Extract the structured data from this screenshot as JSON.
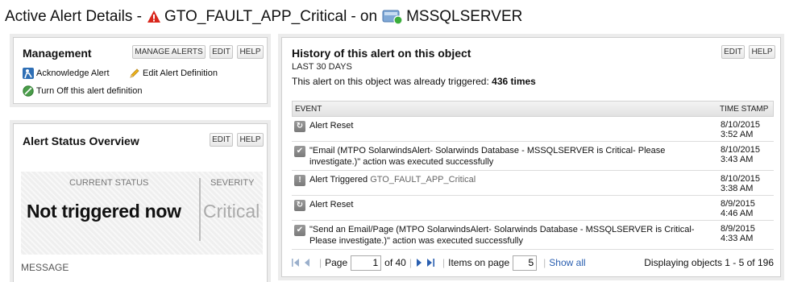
{
  "page": {
    "title_prefix": "Active Alert Details -",
    "alert_name": "GTO_FAULT_APP_Critical",
    "on_label": "- on",
    "object_name": "MSSQLSERVER",
    "warning_icon": "warning-triangle-icon",
    "server_icon": "sql-server-icon"
  },
  "management": {
    "title": "Management",
    "buttons": {
      "manage": "MANAGE ALERTS",
      "edit": "EDIT",
      "help": "HELP"
    },
    "links": {
      "acknowledge": "Acknowledge Alert",
      "edit_definition": "Edit Alert Definition",
      "turn_off": "Turn Off this alert definition"
    }
  },
  "status_overview": {
    "title": "Alert Status Overview",
    "buttons": {
      "edit": "EDIT",
      "help": "HELP"
    },
    "current_status_label": "CURRENT STATUS",
    "current_status": "Not triggered now",
    "severity_label": "SEVERITY",
    "severity": "Critical",
    "message_label": "MESSAGE"
  },
  "history": {
    "title": "History of this alert on this object",
    "buttons": {
      "edit": "EDIT",
      "help": "HELP"
    },
    "period": "LAST 30 DAYS",
    "triggered_prefix": "This alert on this object was already triggered:",
    "triggered_count": "436 times",
    "columns": {
      "event": "EVENT",
      "timestamp": "TIME STAMP"
    },
    "rows": [
      {
        "icon": "reset-icon",
        "text": "Alert Reset",
        "muted": "",
        "date": "8/10/2015",
        "time": "3:52 AM"
      },
      {
        "icon": "check-icon",
        "text": "\"Email (MTPO SolarwindsAlert- Solarwinds Database - MSSQLSERVER is Critical- Please investigate.)\" action was executed successfully",
        "muted": "",
        "date": "8/10/2015",
        "time": "3:43 AM"
      },
      {
        "icon": "exclamation-icon",
        "text": "Alert Triggered",
        "muted": "GTO_FAULT_APP_Critical",
        "date": "8/10/2015",
        "time": "3:38 AM"
      },
      {
        "icon": "reset-icon",
        "text": "Alert Reset",
        "muted": "",
        "date": "8/9/2015",
        "time": "4:46 AM"
      },
      {
        "icon": "check-icon",
        "text": "\"Send an Email/Page (MTPO SolarwindsAlert- Solarwinds Database - MSSQLSERVER is Critical- Please investigate.)\" action was executed successfully",
        "muted": "",
        "date": "8/9/2015",
        "time": "4:33 AM"
      }
    ],
    "pager": {
      "page_label": "Page",
      "page_value": "1",
      "of_label": "of 40",
      "items_label": "Items on page",
      "items_value": "5",
      "show_all": "Show all",
      "displaying": "Displaying objects 1 - 5 of 196"
    }
  },
  "colors": {
    "warning_red": "#d9271c",
    "link_blue": "#2a5fb0",
    "severity_gray": "#aaaaaa",
    "status_green": "#3cae3c"
  }
}
